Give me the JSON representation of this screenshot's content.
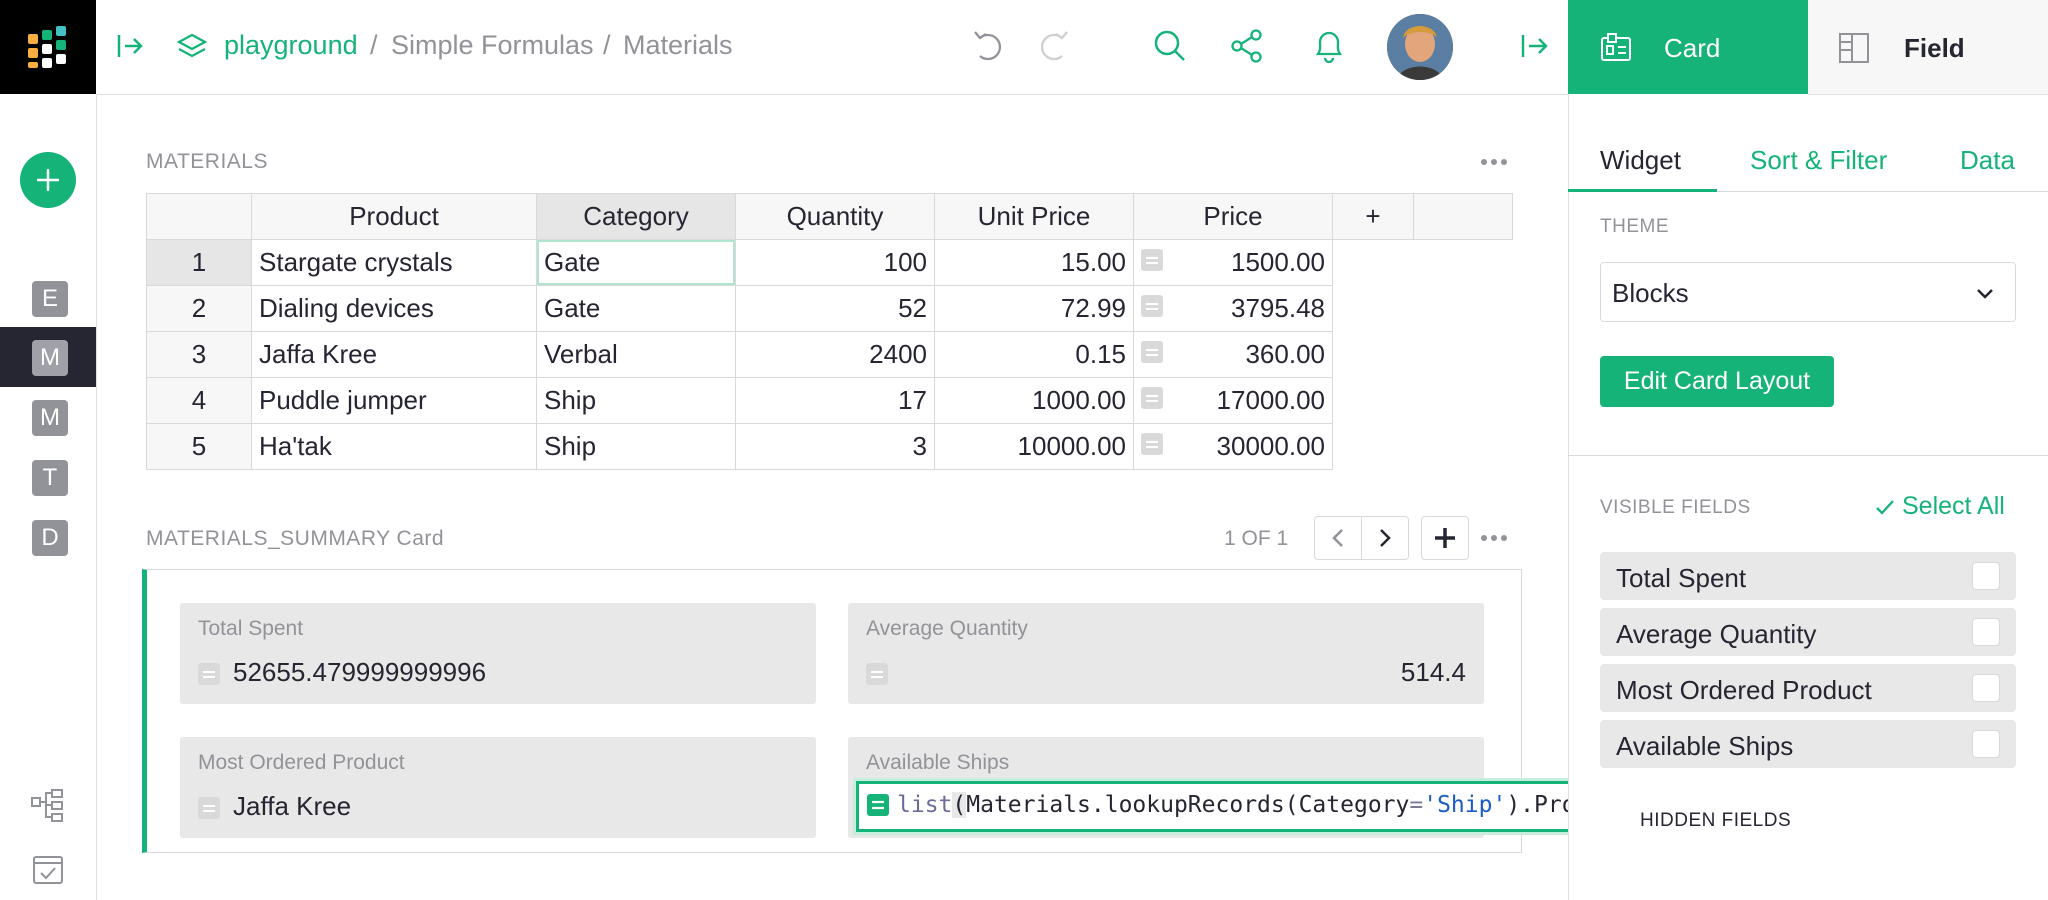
{
  "breadcrumb": {
    "workspace": "playground",
    "sep1": "/",
    "document": "Simple Formulas",
    "sep2": "/",
    "page": "Materials"
  },
  "left_rail": {
    "pages": [
      "E",
      "M",
      "M",
      "T",
      "D"
    ]
  },
  "materials": {
    "title": "MATERIALS",
    "columns": [
      "Product",
      "Category",
      "Quantity",
      "Unit Price",
      "Price",
      "+"
    ],
    "rows": [
      {
        "n": "1",
        "product": "Stargate crystals",
        "category": "Gate",
        "quantity": "100",
        "unit_price": "15.00",
        "price": "1500.00"
      },
      {
        "n": "2",
        "product": "Dialing devices",
        "category": "Gate",
        "quantity": "52",
        "unit_price": "72.99",
        "price": "3795.48"
      },
      {
        "n": "3",
        "product": "Jaffa Kree",
        "category": "Verbal",
        "quantity": "2400",
        "unit_price": "0.15",
        "price": "360.00"
      },
      {
        "n": "4",
        "product": "Puddle jumper",
        "category": "Ship",
        "quantity": "17",
        "unit_price": "1000.00",
        "price": "17000.00"
      },
      {
        "n": "5",
        "product": "Ha'tak",
        "category": "Ship",
        "quantity": "3",
        "unit_price": "10000.00",
        "price": "30000.00"
      }
    ]
  },
  "summary_card": {
    "title": "MATERIALS_SUMMARY Card",
    "pager": "1 OF 1",
    "fields": {
      "total_spent": {
        "label": "Total Spent",
        "value": "52655.479999999996"
      },
      "average_quantity": {
        "label": "Average Quantity",
        "value": "514.4"
      },
      "most_ordered": {
        "label": "Most Ordered Product",
        "value": "Jaffa Kree"
      },
      "available_ships": {
        "label": "Available Ships"
      }
    },
    "formula": {
      "fn": "list",
      "open": "(",
      "obj": "Materials.lookupRecords(Category",
      "eq": "=",
      "str": "'Ship'",
      "close": ").Product)"
    }
  },
  "right_panel": {
    "top_tabs": {
      "card": "Card",
      "field": "Field"
    },
    "sub_tabs": {
      "widget": "Widget",
      "sort_filter": "Sort & Filter",
      "data": "Data"
    },
    "theme_label": "THEME",
    "theme_value": "Blocks",
    "edit_layout": "Edit Card Layout",
    "visible_fields_label": "VISIBLE FIELDS",
    "select_all": "Select All",
    "visible_fields": [
      "Total Spent",
      "Average Quantity",
      "Most Ordered Product",
      "Available Ships"
    ],
    "hidden_fields_label": "HIDDEN FIELDS"
  },
  "colors": {
    "accent": "#16b378",
    "dark": "#262633",
    "muted": "#929299"
  }
}
